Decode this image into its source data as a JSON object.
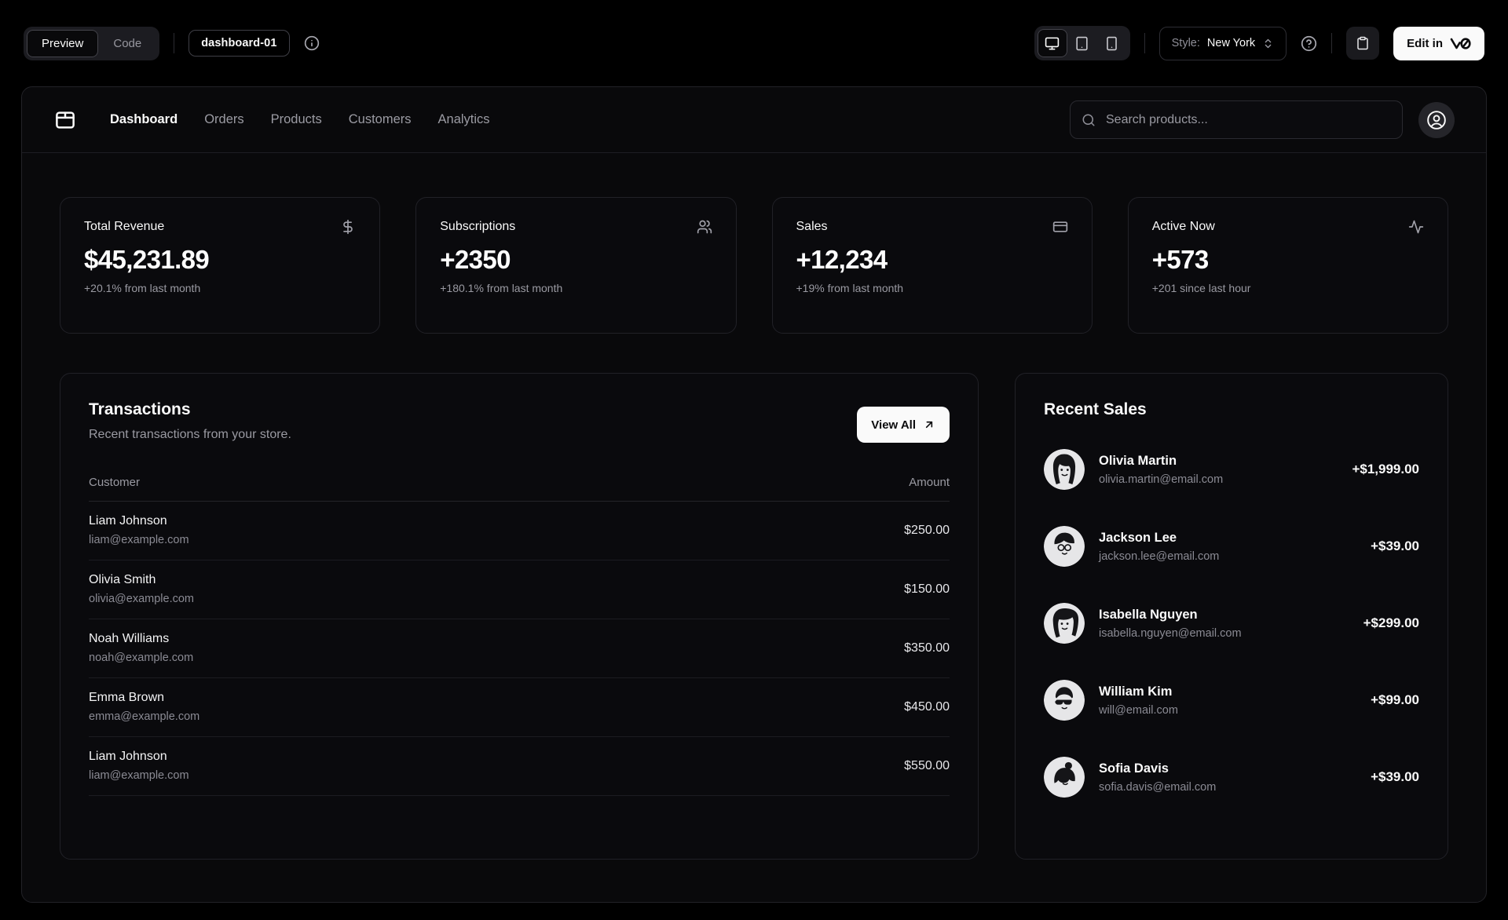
{
  "toolbar": {
    "preview_label": "Preview",
    "code_label": "Code",
    "block_name": "dashboard-01",
    "style_label": "Style:",
    "style_value": "New York",
    "edit_button_label": "Edit in"
  },
  "nav": {
    "items": [
      {
        "label": "Dashboard",
        "active": true
      },
      {
        "label": "Orders",
        "active": false
      },
      {
        "label": "Products",
        "active": false
      },
      {
        "label": "Customers",
        "active": false
      },
      {
        "label": "Analytics",
        "active": false
      }
    ],
    "search_placeholder": "Search products..."
  },
  "stats": [
    {
      "title": "Total Revenue",
      "icon": "dollar-sign-icon",
      "value": "$45,231.89",
      "change": "+20.1% from last month"
    },
    {
      "title": "Subscriptions",
      "icon": "users-icon",
      "value": "+2350",
      "change": "+180.1% from last month"
    },
    {
      "title": "Sales",
      "icon": "credit-card-icon",
      "value": "+12,234",
      "change": "+19% from last month"
    },
    {
      "title": "Active Now",
      "icon": "activity-icon",
      "value": "+573",
      "change": "+201 since last hour"
    }
  ],
  "transactions": {
    "title": "Transactions",
    "subtitle": "Recent transactions from your store.",
    "view_all_label": "View All",
    "columns": [
      "Customer",
      "Amount"
    ],
    "rows": [
      {
        "name": "Liam Johnson",
        "email": "liam@example.com",
        "amount": "$250.00"
      },
      {
        "name": "Olivia Smith",
        "email": "olivia@example.com",
        "amount": "$150.00"
      },
      {
        "name": "Noah Williams",
        "email": "noah@example.com",
        "amount": "$350.00"
      },
      {
        "name": "Emma Brown",
        "email": "emma@example.com",
        "amount": "$450.00"
      },
      {
        "name": "Liam Johnson",
        "email": "liam@example.com",
        "amount": "$550.00"
      }
    ]
  },
  "recent_sales": {
    "title": "Recent Sales",
    "rows": [
      {
        "name": "Olivia Martin",
        "email": "olivia.martin@email.com",
        "amount": "+$1,999.00"
      },
      {
        "name": "Jackson Lee",
        "email": "jackson.lee@email.com",
        "amount": "+$39.00"
      },
      {
        "name": "Isabella Nguyen",
        "email": "isabella.nguyen@email.com",
        "amount": "+$299.00"
      },
      {
        "name": "William Kim",
        "email": "will@email.com",
        "amount": "+$99.00"
      },
      {
        "name": "Sofia Davis",
        "email": "sofia.davis@email.com",
        "amount": "+$39.00"
      }
    ]
  },
  "colors": {
    "background": "#000000",
    "panel_background": "#09090b",
    "card_border": "#212127",
    "foreground": "#fafafa",
    "muted_text": "#9a9aa2",
    "primary_button": "#fafafa"
  }
}
